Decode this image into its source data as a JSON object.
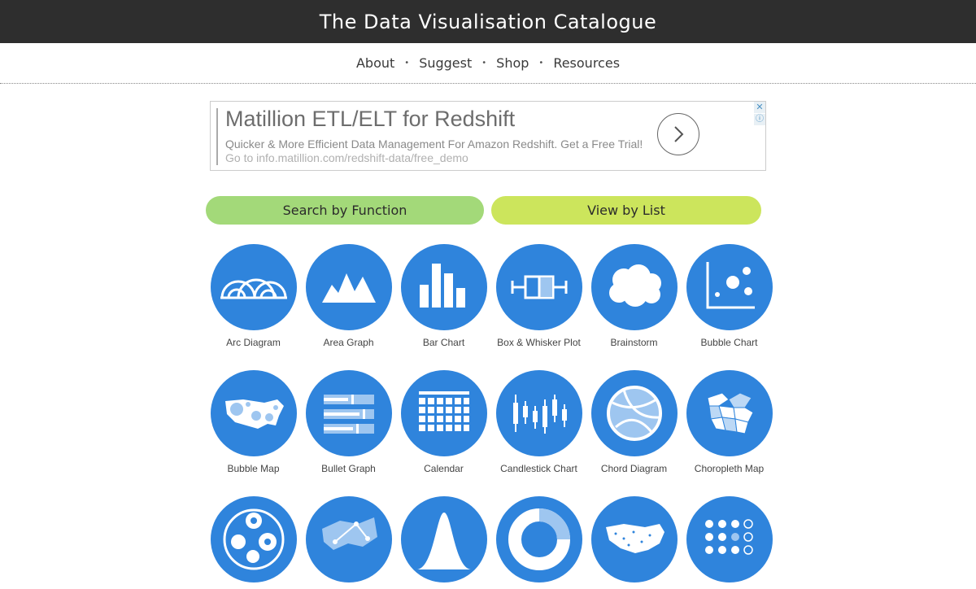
{
  "header": {
    "title": "The Data Visualisation Catalogue"
  },
  "nav": {
    "items": [
      "About",
      "Suggest",
      "Shop",
      "Resources"
    ],
    "separator": "•"
  },
  "ad": {
    "headline": "Matillion ETL/ELT for Redshift",
    "description": "Quicker & More Efficient Data Management For Amazon Redshift. Get a Free Trial!",
    "url_text": "Go to info.matillion.com/redshift-data/free_demo",
    "close_glyph": "✕",
    "info_glyph": "ⓘ"
  },
  "buttons": {
    "search_by_function": "Search by Function",
    "view_by_list": "View by List"
  },
  "catalogue": {
    "items": [
      {
        "label": "Arc Diagram",
        "icon": "arc-diagram-icon"
      },
      {
        "label": "Area Graph",
        "icon": "area-graph-icon"
      },
      {
        "label": "Bar Chart",
        "icon": "bar-chart-icon"
      },
      {
        "label": "Box & Whisker Plot",
        "icon": "box-whisker-icon"
      },
      {
        "label": "Brainstorm",
        "icon": "brainstorm-icon"
      },
      {
        "label": "Bubble Chart",
        "icon": "bubble-chart-icon"
      },
      {
        "label": "Bubble Map",
        "icon": "bubble-map-icon"
      },
      {
        "label": "Bullet Graph",
        "icon": "bullet-graph-icon"
      },
      {
        "label": "Calendar",
        "icon": "calendar-icon"
      },
      {
        "label": "Candlestick Chart",
        "icon": "candlestick-icon"
      },
      {
        "label": "Chord Diagram",
        "icon": "chord-diagram-icon"
      },
      {
        "label": "Choropleth Map",
        "icon": "choropleth-map-icon"
      },
      {
        "label": "",
        "icon": "circle-packing-icon"
      },
      {
        "label": "",
        "icon": "connection-map-icon"
      },
      {
        "label": "",
        "icon": "density-plot-icon"
      },
      {
        "label": "",
        "icon": "donut-chart-icon"
      },
      {
        "label": "",
        "icon": "dot-map-icon"
      },
      {
        "label": "",
        "icon": "dot-matrix-icon"
      }
    ]
  },
  "colors": {
    "header_bg": "#2e2e2e",
    "circle_blue": "#2f84dc",
    "pill_green": "#a3d979",
    "pill_lime": "#cce55c"
  }
}
